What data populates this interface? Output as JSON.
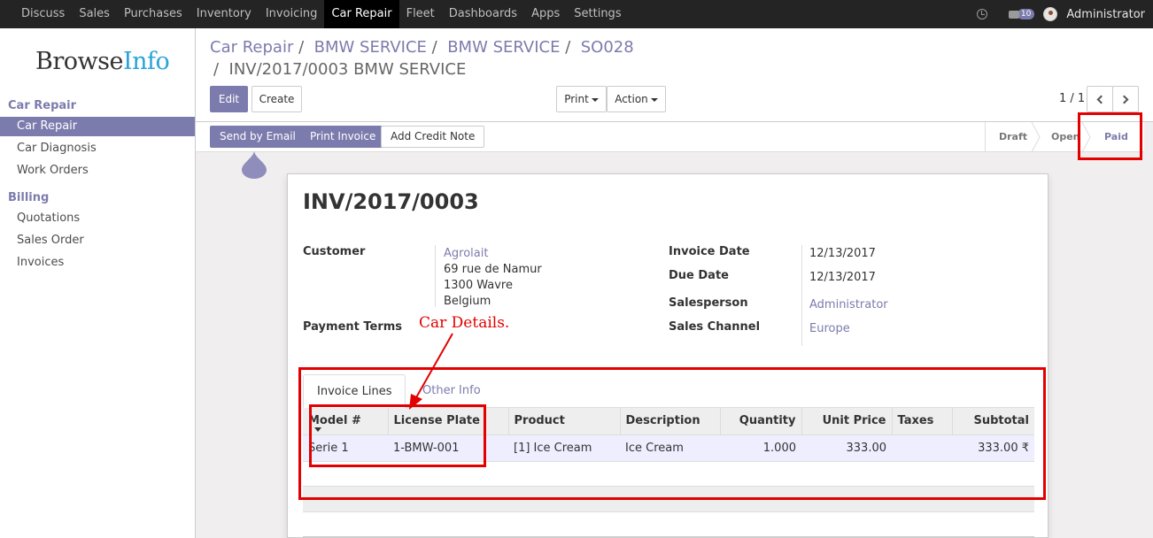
{
  "topnav": {
    "items": [
      "Discuss",
      "Sales",
      "Purchases",
      "Inventory",
      "Invoicing",
      "Car Repair",
      "Fleet",
      "Dashboards",
      "Apps",
      "Settings"
    ],
    "active": "Car Repair",
    "badge": "10",
    "user": "Administrator"
  },
  "sidebar": {
    "logo_a": "Browse",
    "logo_b": "Info",
    "section1": "Car Repair",
    "items1": [
      "Car Repair",
      "Car Diagnosis",
      "Work Orders"
    ],
    "section2": "Billing",
    "items2": [
      "Quotations",
      "Sales Order",
      "Invoices"
    ]
  },
  "breadcrumb": {
    "c1": "Car Repair",
    "c2": "BMW SERVICE",
    "c3": "BMW SERVICE",
    "c4": "SO028",
    "current": "INV/2017/0003 BMW SERVICE",
    "sep": "/"
  },
  "buttons": {
    "edit": "Edit",
    "create": "Create",
    "print": "Print",
    "action": "Action",
    "pager": "1 / 1",
    "send_email": "Send by Email",
    "print_invoice": "Print Invoice",
    "credit_note": "Add Credit Note"
  },
  "stages": [
    "Draft",
    "Open",
    "Paid"
  ],
  "invoice": {
    "number": "INV/2017/0003",
    "customer_label": "Customer",
    "customer_name": "Agrolait",
    "addr1": "69 rue de Namur",
    "addr2": "1300 Wavre",
    "addr3": "Belgium",
    "payment_terms_label": "Payment Terms",
    "invoice_date_label": "Invoice Date",
    "invoice_date": "12/13/2017",
    "due_date_label": "Due Date",
    "due_date": "12/13/2017",
    "salesperson_label": "Salesperson",
    "salesperson": "Administrator",
    "channel_label": "Sales Channel",
    "channel": "Europe"
  },
  "tabs": [
    "Invoice Lines",
    "Other Info"
  ],
  "lines": {
    "headers": [
      "Model #",
      "License Plate",
      "Product",
      "Description",
      "Quantity",
      "Unit Price",
      "Taxes",
      "Subtotal"
    ],
    "rows": [
      [
        "Serie 1",
        "1-BMW-001",
        "[1] Ice Cream",
        "Ice Cream",
        "1.000",
        "333.00",
        "",
        "333.00 ₹"
      ]
    ]
  },
  "annotation": "Car Details.",
  "colors": {
    "accent": "#7c7bad",
    "annotation": "#e20000",
    "topbar": "#242424"
  }
}
